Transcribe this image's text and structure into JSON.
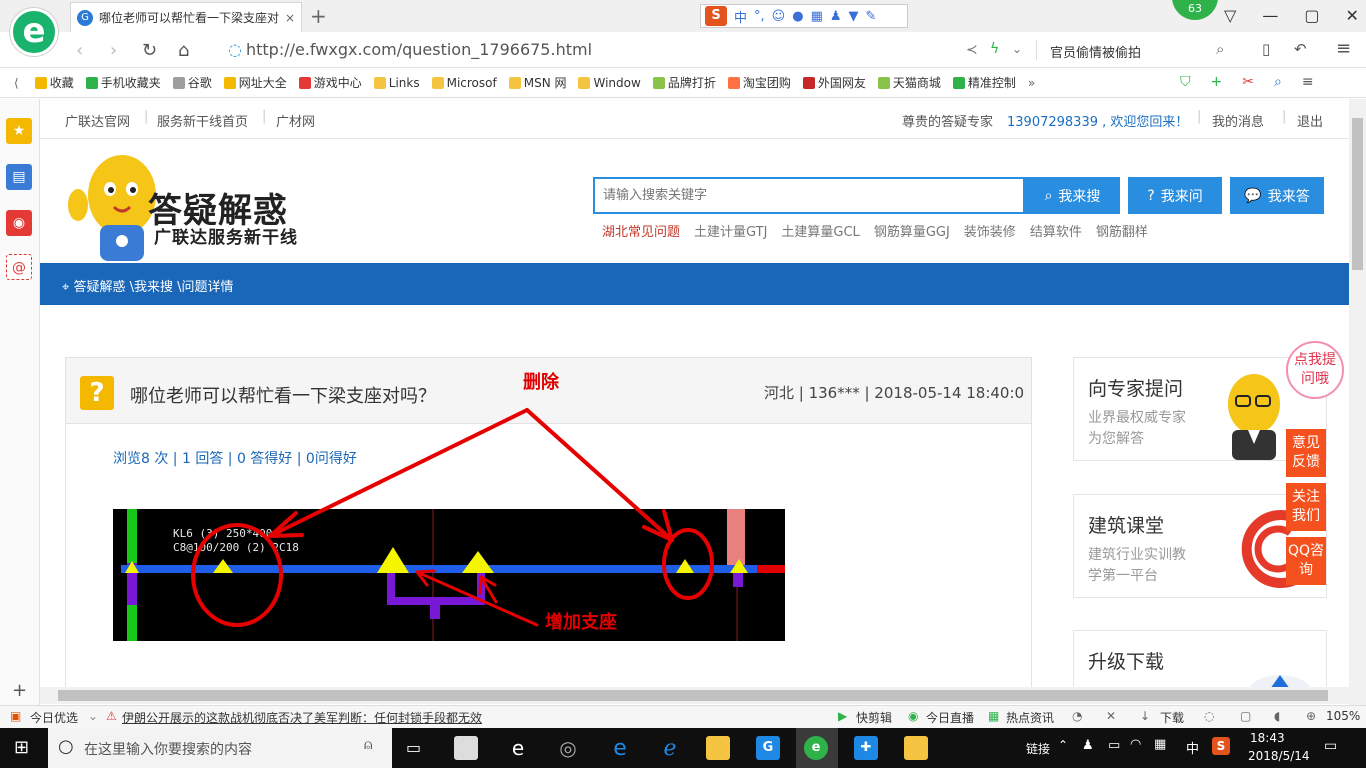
{
  "browser": {
    "tab_title": "哪位老师可以帮忙看一下梁支座对吗？",
    "tab_close": "×",
    "new_tab": "+",
    "url": "http://e.fwxgx.com/question_1796675.html",
    "search_hint": "官员偷情被偷拍",
    "badge": "63",
    "ime_label": "中",
    "zoom": "105%"
  },
  "bookmarks": [
    {
      "label": "收藏",
      "color": "#f5b800"
    },
    {
      "label": "手机收藏夹",
      "color": "#2fb24a"
    },
    {
      "label": "谷歌",
      "color": "#9e9e9e"
    },
    {
      "label": "网址大全",
      "color": "#f5b800"
    },
    {
      "label": "游戏中心",
      "color": "#e53935"
    },
    {
      "label": "Links",
      "color": "#f5c542"
    },
    {
      "label": "Microsof",
      "color": "#f5c542"
    },
    {
      "label": "MSN 网",
      "color": "#f5c542"
    },
    {
      "label": "Window",
      "color": "#f5c542"
    },
    {
      "label": "品牌打折",
      "color": "#8bc34a"
    },
    {
      "label": "淘宝团购",
      "color": "#ff7043"
    },
    {
      "label": "外国网友",
      "color": "#c62828"
    },
    {
      "label": "天猫商城",
      "color": "#8bc34a"
    },
    {
      "label": "精准控制",
      "color": "#2fb24a"
    }
  ],
  "topnav": {
    "links": [
      "广联达官网",
      "服务新干线首页",
      "广材网"
    ],
    "expert": "尊贵的答疑专家",
    "welcome": "13907298339 , 欢迎您回来！",
    "messages": "我的消息",
    "logout": "退出"
  },
  "brand": {
    "title": "答疑解惑",
    "subtitle": "广联达服务新干线"
  },
  "search": {
    "placeholder": "请输入搜索关键字",
    "btn_search": "我来搜",
    "btn_ask": "我来问",
    "btn_answer": "我来答",
    "hot": [
      "湖北常见问题",
      "土建计量GTJ",
      "土建算量GCL",
      "钢筋算量GGJ",
      "装饰装修",
      "结算软件",
      "钢筋翻样"
    ]
  },
  "breadcrumb": "答疑解惑 \\我来搜 \\问题详情",
  "question": {
    "icon": "?",
    "title": "哪位老师可以帮忙看一下梁支座对吗？",
    "meta": "河北 | 136*** | 2018-05-14 18:40:0",
    "stats": "浏览8 次 | 1 回答 | 0 答得好 | 0问得好"
  },
  "annotations": {
    "delete": "删除",
    "add_support": "增加支座"
  },
  "cad": {
    "label1": "KL6 (3) 250*400",
    "label2": "C8@100/200 (2) 2C18"
  },
  "right": {
    "expert_title": "向专家提问",
    "expert_sub1": "业界最权威专家",
    "expert_sub2": "为您解答",
    "course_title": "建筑课堂",
    "course_sub1": "建筑行业实训教",
    "course_sub2": "学第一平台",
    "download_title": "升级下载",
    "bubble": "点我提问哦",
    "float_buttons": [
      "意见反馈",
      "关注我们",
      "QQ咨询"
    ]
  },
  "statusbar": {
    "today": "今日优选",
    "news": "伊朗公开展示的这款战机彻底否决了美军判断：任何封锁手段都无效",
    "items": [
      "快剪辑",
      "今日直播",
      "热点资讯",
      "下载"
    ],
    "zoom": "105%"
  },
  "taskbar": {
    "search_placeholder": "在这里输入你要搜索的内容",
    "link": "链接",
    "ime": "中",
    "time": "18:43",
    "date": "2018/5/14"
  }
}
